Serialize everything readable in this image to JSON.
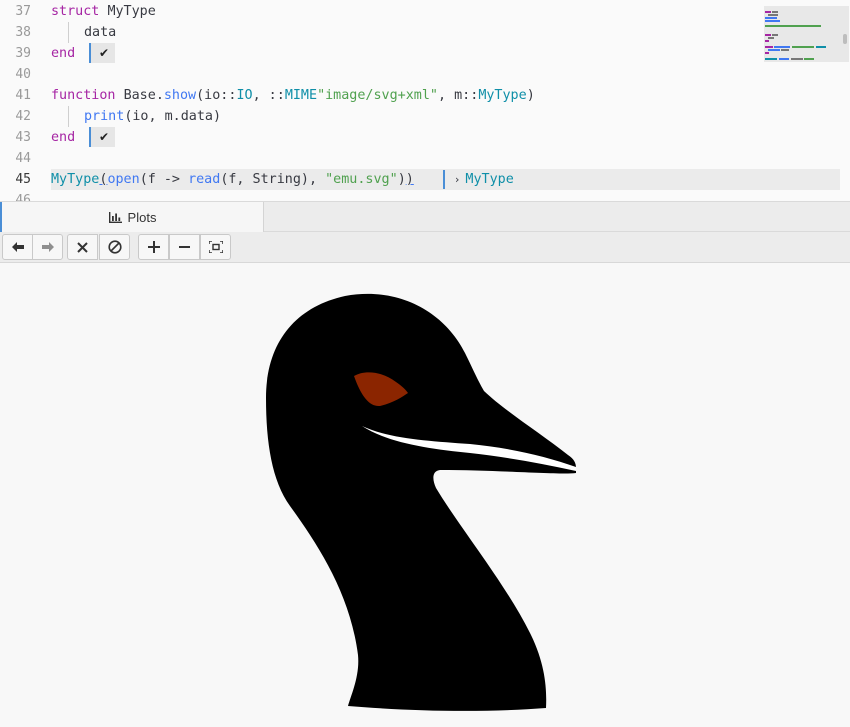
{
  "editor": {
    "line_numbers": [
      "37",
      "38",
      "39",
      "40",
      "41",
      "42",
      "43",
      "44",
      "45",
      "46"
    ],
    "lines": {
      "l37": {
        "kw": "struct",
        "name": "MyType"
      },
      "l38": {
        "field": "data"
      },
      "l39": {
        "kw": "end"
      },
      "l41": {
        "kw": "function",
        "mod": "Base",
        "dot": ".",
        "fn": "show",
        "p1": "(io::",
        "io_type": "IO",
        "p2": ", ::",
        "mime": "MIME",
        "mime_str": "\"image/svg+xml\"",
        "p3": ", m::",
        "mtype": "MyType",
        "p4": ")"
      },
      "l42": {
        "fn": "print",
        "args": "(io, m.data)"
      },
      "l43": {
        "kw": "end"
      },
      "l45": {
        "ctor": "MyType",
        "open_paren": "(",
        "open_fn": "open",
        "p1": "(f -> ",
        "read_fn": "read",
        "p2": "(f, String), ",
        "file_str": "\"emu.svg\"",
        "p3": ")",
        "close_paren": ")"
      }
    },
    "check_badges": [
      "✔",
      "✔"
    ],
    "inline_result": {
      "chevron": "›",
      "value": "MyType"
    },
    "colors": {
      "keyword": "#a626a4",
      "function": "#4078f2",
      "type": "#0f8fa8",
      "string": "#50a14f",
      "accent": "#4a8ed6"
    }
  },
  "panel": {
    "tab_label": "Plots",
    "tab_icon": "bar-chart-icon"
  },
  "toolbar": {
    "buttons": [
      {
        "name": "back-button",
        "icon": "arrow-left-icon",
        "glyph": "🡐"
      },
      {
        "name": "forward-button",
        "icon": "arrow-right-icon",
        "glyph": "🡒"
      },
      {
        "name": "close-plot-button",
        "icon": "close-icon",
        "glyph": "✕"
      },
      {
        "name": "clear-all-button",
        "icon": "forbidden-icon",
        "glyph": "⊘"
      },
      {
        "name": "zoom-in-button",
        "icon": "plus-icon",
        "glyph": "+"
      },
      {
        "name": "zoom-out-button",
        "icon": "minus-icon",
        "glyph": "−"
      },
      {
        "name": "fit-button",
        "icon": "fit-screen-icon",
        "glyph": "⛶"
      }
    ]
  },
  "plot": {
    "image": "emu-head-icon",
    "colors": {
      "head": "#000000",
      "eye": "#8b2500",
      "beak_line": "#ffffff"
    }
  }
}
